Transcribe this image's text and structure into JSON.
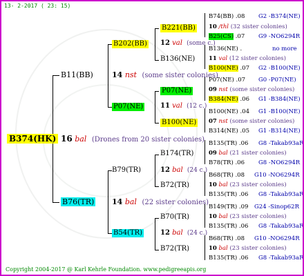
{
  "header": "13-  2-2017 ( 23: 15)",
  "footer": "Copyright 2004-2017 @ Karl Kehrle Foundation.   www.pedigreeapis.org",
  "root": {
    "name": "B374(HK)",
    "num": "16",
    "type": "bal",
    "note": "(Drones from 20 sister colonies)"
  },
  "queen": {
    "name": "B11(BB)",
    "num": "14",
    "type": "nst",
    "note": "(some sister colonies)"
  },
  "drone_sire": {
    "name": "B76(TR)",
    "num": "14",
    "type": "bal",
    "note": "(22 sister colonies)"
  },
  "q_mother": {
    "name": "B202(BB)",
    "num": "12",
    "type": "val",
    "note": "(some c.)"
  },
  "q_father": {
    "name": "P07(NE)",
    "num": "11",
    "type": "val",
    "note": "(12 c.)"
  },
  "d_mother": {
    "name": "B79(TR)",
    "num": "12",
    "type": "bal",
    "note": "(24 c.)"
  },
  "d_father": {
    "name": "B54(TR)",
    "num": "12",
    "type": "bal",
    "note": "(24 c.)"
  },
  "g1": {
    "name": "B221(BB)",
    "num": "10",
    "type": "/thl",
    "note": "(32 sister colonies)"
  },
  "g2": {
    "name": "B136(NE)",
    "num": "11",
    "type": "val",
    "note": "(12 sister colonies)"
  },
  "g3": {
    "name": "P07(NE)",
    "num": "09",
    "type": "nst",
    "note": "(some sister colonies)"
  },
  "g4": {
    "name": "B100(NE)",
    "num": "07",
    "type": "nst",
    "note": "(some sister colonies)"
  },
  "g5": {
    "name": "B174(TR)",
    "num": "09",
    "type": "bal",
    "note": "(21 sister colonies)"
  },
  "g6": {
    "name": "B72(TR)",
    "num": "10",
    "type": "bal",
    "note": "(23 sister colonies)"
  },
  "g7": {
    "name": "B70(TR)",
    "num": "10",
    "type": "bal",
    "note": "(23 sister colonies)"
  },
  "g8": {
    "name": "B72(TR)",
    "num": "10",
    "type": "bal",
    "note": "(23 sister colonies)"
  },
  "p": [
    {
      "name": "B74(BB)",
      "yr": ".08",
      "ref": "G2 -B374(NE)"
    },
    {
      "name": "B25(CS)",
      "yr": ".07",
      "ref": "G9 -NO6294R"
    },
    {
      "name": "B136(NE)",
      "yr": ".",
      "ref": "no more"
    },
    {
      "name": "B100(NE)",
      "yr": ".07",
      "ref": "G2 -B100(NE)"
    },
    {
      "name": "P07(NE)",
      "yr": ".07",
      "ref": "G0 -P07(NE)"
    },
    {
      "name": "B384(NE)",
      "yr": ".06",
      "ref": "G1 -B384(NE)"
    },
    {
      "name": "B100(NE)",
      "yr": ".04",
      "ref": "G1 -B100(NE)"
    },
    {
      "name": "B314(NE)",
      "yr": ".05",
      "ref": "G1 -B314(NE)"
    },
    {
      "name": "B135(TR)",
      "yr": ".06",
      "ref": "G8 -Takab93aR"
    },
    {
      "name": "B78(TR)",
      "yr": ".06",
      "ref": "G8 -NO6294R"
    },
    {
      "name": "B68(TR)",
      "yr": ".08",
      "ref": "G10 -NO6294R"
    },
    {
      "name": "B135(TR)",
      "yr": ".06",
      "ref": "G8 -Takab93aR"
    },
    {
      "name": "B149(TR)",
      "yr": ".09",
      "ref": "G24 -Sinop62R"
    },
    {
      "name": "B135(TR)",
      "yr": ".06",
      "ref": "G8 -Takab93aR"
    },
    {
      "name": "B68(TR)",
      "yr": ".08",
      "ref": "G10 -NO6294R"
    },
    {
      "name": "B135(TR)",
      "yr": ".06",
      "ref": "G8 -Takab93aR"
    }
  ]
}
